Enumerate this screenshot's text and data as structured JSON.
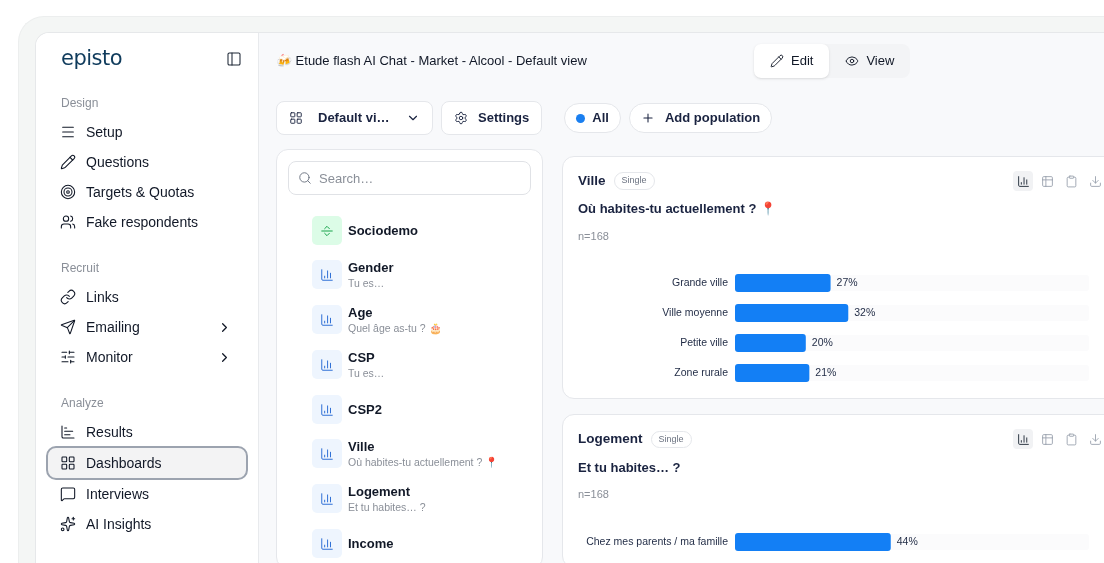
{
  "sidebar": {
    "logo": "episto",
    "sections": [
      {
        "title": "Design",
        "items": [
          {
            "label": "Setup",
            "selected": false,
            "has_submenu": false
          },
          {
            "label": "Questions",
            "selected": false,
            "has_submenu": false
          },
          {
            "label": "Targets & Quotas",
            "selected": false,
            "has_submenu": false
          },
          {
            "label": "Fake respondents",
            "selected": false,
            "has_submenu": false
          }
        ]
      },
      {
        "title": "Recruit",
        "items": [
          {
            "label": "Links",
            "selected": false,
            "has_submenu": false
          },
          {
            "label": "Emailing",
            "selected": false,
            "has_submenu": true
          },
          {
            "label": "Monitor",
            "selected": false,
            "has_submenu": true
          }
        ]
      },
      {
        "title": "Analyze",
        "items": [
          {
            "label": "Results",
            "selected": false,
            "has_submenu": false
          },
          {
            "label": "Dashboards",
            "selected": true,
            "has_submenu": false
          },
          {
            "label": "Interviews",
            "selected": false,
            "has_submenu": false
          },
          {
            "label": "AI Insights",
            "selected": false,
            "has_submenu": false
          }
        ]
      }
    ]
  },
  "header": {
    "title": "🍻 Etude flash AI Chat - Market - Alcool - Default view",
    "modes": [
      {
        "label": "Edit",
        "selected": true
      },
      {
        "label": "View",
        "selected": false
      }
    ]
  },
  "toolbar": {
    "view_select": "Default vi…",
    "settings": "Settings",
    "populations": [
      {
        "label": "All",
        "color": "#1a7ff0"
      }
    ],
    "add_population": "Add population"
  },
  "question_list": {
    "search_placeholder": "Search…",
    "items": [
      {
        "kind": "section",
        "title": "Sociodemo"
      },
      {
        "kind": "question",
        "title": "Gender",
        "subtitle": "Tu es…"
      },
      {
        "kind": "question",
        "title": "Age",
        "subtitle": "Quel âge as-tu ? 🎂"
      },
      {
        "kind": "question",
        "title": "CSP",
        "subtitle": "Tu es…"
      },
      {
        "kind": "question",
        "title": "CSP2"
      },
      {
        "kind": "question",
        "title": "Ville",
        "subtitle": "Où habites-tu actuellement ? 📍"
      },
      {
        "kind": "question",
        "title": "Logement",
        "subtitle": "Et tu habites… ?"
      },
      {
        "kind": "question",
        "title": "Income"
      }
    ]
  },
  "cards": [
    {
      "title": "Ville",
      "badge": "Single",
      "question": "Où habites-tu actuellement ? 📍",
      "count": "n=168",
      "view_buttons": [
        {
          "kind": "chart",
          "selected": true
        },
        {
          "kind": "table",
          "selected": false
        },
        {
          "kind": "copy",
          "selected": false
        },
        {
          "kind": "download",
          "selected": false
        }
      ],
      "chart_data": {
        "type": "bar",
        "orientation": "horizontal",
        "categories": [
          "Grande ville",
          "Ville moyenne",
          "Petite ville",
          "Zone rurale"
        ],
        "values": [
          27,
          32,
          20,
          21
        ],
        "value_labels": [
          "27%",
          "32%",
          "20%",
          "21%"
        ]
      }
    },
    {
      "title": "Logement",
      "badge": "Single",
      "question": "Et tu habites… ?",
      "count": "n=168",
      "view_buttons": [
        {
          "kind": "chart",
          "selected": true
        },
        {
          "kind": "table",
          "selected": false
        },
        {
          "kind": "copy",
          "selected": false
        },
        {
          "kind": "download",
          "selected": false
        }
      ],
      "chart_data": {
        "type": "bar",
        "orientation": "horizontal",
        "categories": [
          "Chez mes parents / ma famille"
        ],
        "values": [
          44
        ],
        "value_labels": [
          "44%"
        ]
      }
    }
  ]
}
